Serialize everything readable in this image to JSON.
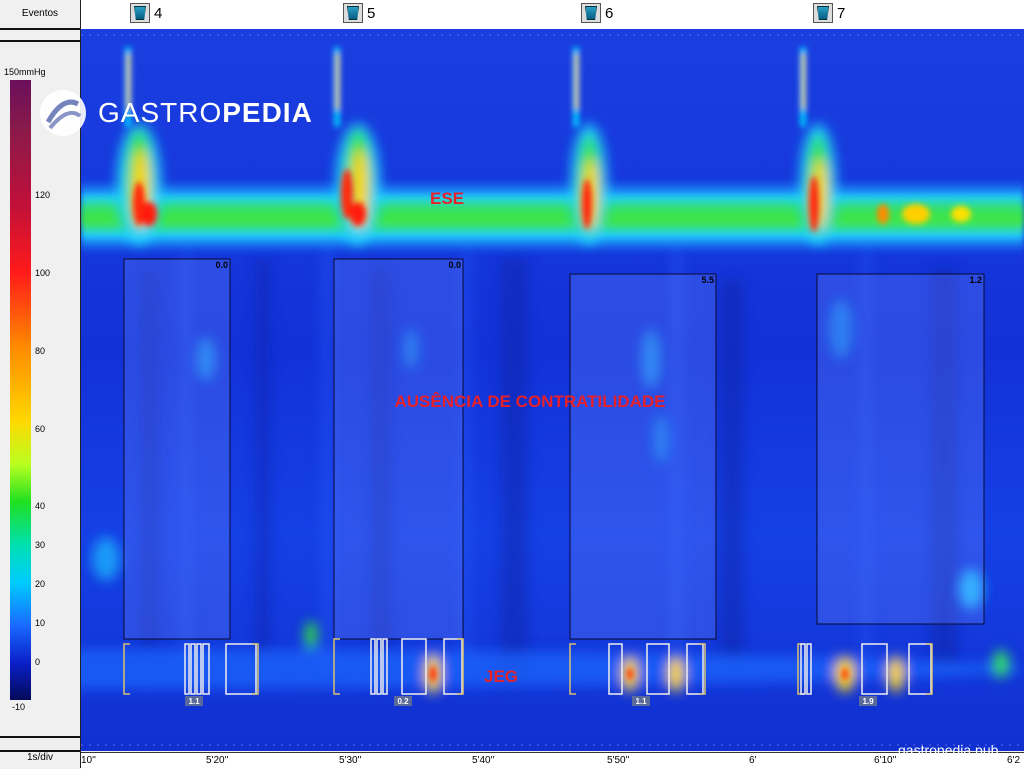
{
  "left_panel": {
    "events_label": "Eventos",
    "scale_unit": "150mmHg",
    "time_per_div": "1s/div"
  },
  "colorbar": {
    "ticks": [
      "120",
      "100",
      "80",
      "60",
      "40",
      "30",
      "20",
      "10",
      "0",
      "-10"
    ],
    "tick_values": [
      120,
      100,
      80,
      60,
      40,
      30,
      20,
      10,
      0,
      -10
    ]
  },
  "events": [
    {
      "label": "4"
    },
    {
      "label": "5"
    },
    {
      "label": "6"
    },
    {
      "label": "7"
    }
  ],
  "annotations": {
    "upper": "ESE",
    "middle": "AUSÊNCIA DE CONTRATILIDADE",
    "lower": "JEG"
  },
  "box_values": [
    "0.0",
    "0.0",
    "5.5",
    "1.2"
  ],
  "lower_values": [
    "1.1",
    "0.2",
    "1.1",
    "1.9"
  ],
  "x_ticks": [
    "10''",
    "5'20''",
    "5'30''",
    "5'40''",
    "5'50''",
    "6'",
    "6'10''",
    "6'2"
  ],
  "logo": {
    "text_part1": "GASTRO",
    "text_part2": "PEDIA"
  },
  "watermark": "gastropedia.pub",
  "chart_data": {
    "type": "heatmap",
    "title": "",
    "x_tick_labels": [
      "10''",
      "5'20''",
      "5'30''",
      "5'40''",
      "5'50''",
      "6'",
      "6'10''",
      "6'2"
    ],
    "color_scale": {
      "unit": "mmHg",
      "min": -10,
      "max": 150
    },
    "swallows": [
      {
        "event": "4",
        "irp_box_value": 0.0,
        "lower_value": 1.1
      },
      {
        "event": "5",
        "irp_box_value": 0.0,
        "lower_value": 0.2
      },
      {
        "event": "6",
        "irp_box_value": 5.5,
        "lower_value": 1.1
      },
      {
        "event": "7",
        "irp_box_value": 1.2,
        "lower_value": 1.9
      }
    ],
    "labels": [
      "ESE",
      "AUSÊNCIA DE CONTRATILIDADE",
      "JEG"
    ]
  }
}
